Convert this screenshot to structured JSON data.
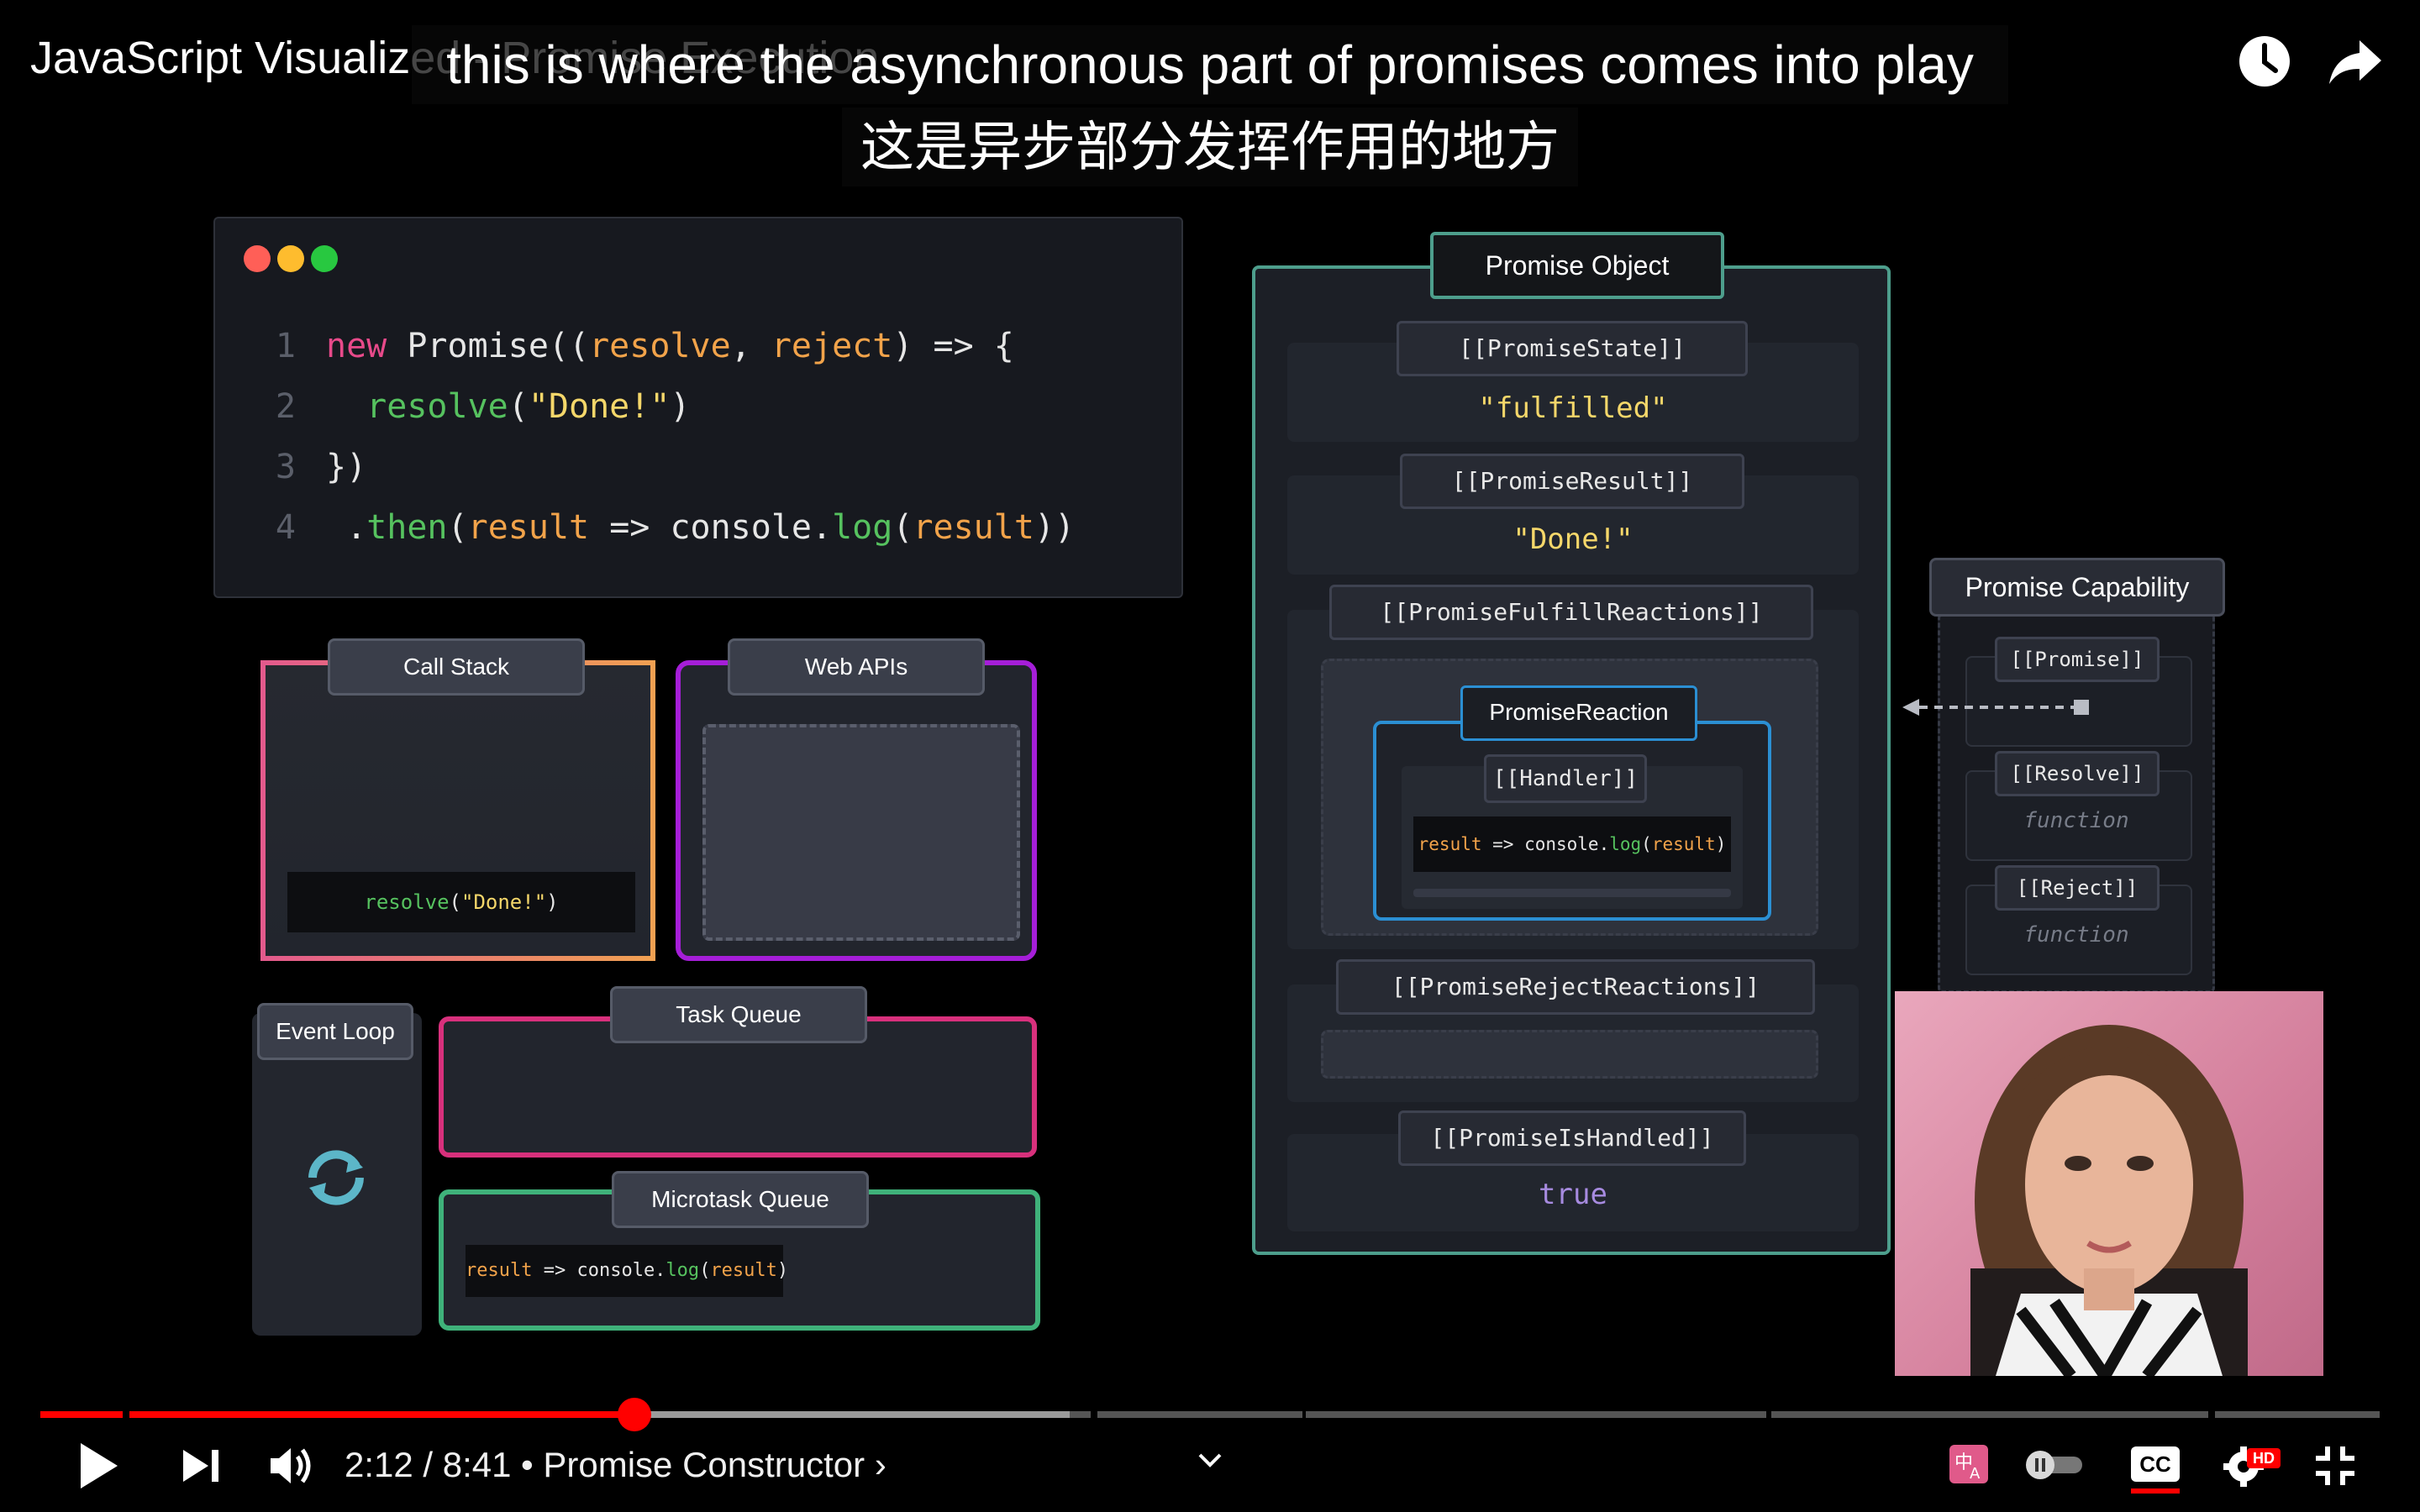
{
  "player": {
    "title": "JavaScript Visualized - Promise Execution",
    "time_current": "2:12",
    "time_separator": "/",
    "time_total": "8:41",
    "chapter": "• Promise Constructor ›",
    "progress_fraction": 0.254,
    "buffered_fraction": 0.44,
    "accent_color": "#ff0000"
  },
  "captions": {
    "line1": "this is where the asynchronous part of promises comes into play",
    "line2": "这是异步部分发挥作用的地方"
  },
  "code": {
    "line_numbers": [
      "1",
      "2",
      "3",
      "4"
    ],
    "l1": {
      "kw": "new",
      "cls": " Promise",
      "p1": "((",
      "a1": "resolve",
      "c": ", ",
      "a2": "reject",
      "p2": ") => {"
    },
    "l2": {
      "fn": "resolve",
      "p1": "(",
      "str": "\"Done!\"",
      "p2": ")"
    },
    "l3": {
      "txt": "})"
    },
    "l4": {
      "dot": ".",
      "fn": "then",
      "p1": "(",
      "a1": "result",
      "arrow": " => ",
      "obj": "console.",
      "fn2": "log",
      "p2": "(",
      "a2": "result",
      "p3": "))"
    }
  },
  "panels": {
    "call_stack": "Call Stack",
    "web_apis": "Web APIs",
    "event_loop": "Event Loop",
    "task_queue": "Task Queue",
    "microtask_queue": "Microtask Queue",
    "call_stack_item": {
      "fn": "resolve",
      "p1": "(",
      "str": "\"Done!\"",
      "p2": ")"
    },
    "microtask_item": {
      "a1": "result",
      "arrow": " => ",
      "obj": "console.",
      "fn": "log",
      "p1": "(",
      "a2": "result",
      "p2": ")"
    }
  },
  "promise_object": {
    "title": "Promise Object",
    "state_label": "[[PromiseState]]",
    "state_value": "\"fulfilled\"",
    "result_label": "[[PromiseResult]]",
    "result_value": "\"Done!\"",
    "fulfill_label": "[[PromiseFulfillReactions]]",
    "reaction_title": "PromiseReaction",
    "handler_label": "[[Handler]]",
    "handler_code": {
      "a1": "result",
      "arrow": " => ",
      "obj": "console.",
      "fn": "log",
      "p1": "(",
      "a2": "result",
      "p2": ")"
    },
    "reject_label": "[[PromiseRejectReactions]]",
    "handled_label": "[[PromiseIsHandled]]",
    "handled_value": "true"
  },
  "promise_capability": {
    "title": "Promise Capability",
    "promise_label": "[[Promise]]",
    "resolve_label": "[[Resolve]]",
    "resolve_value": "function",
    "reject_label": "[[Reject]]",
    "reject_value": "function"
  },
  "icons": [
    "clock-icon",
    "share-icon",
    "play-icon",
    "next-icon",
    "volume-icon",
    "chevron-down-icon",
    "translate-icon",
    "autoplay-toggle",
    "captions-icon",
    "settings-icon",
    "exit-fullscreen-icon",
    "refresh-icon"
  ],
  "badges": {
    "hd": "HD",
    "cc": "CC"
  }
}
